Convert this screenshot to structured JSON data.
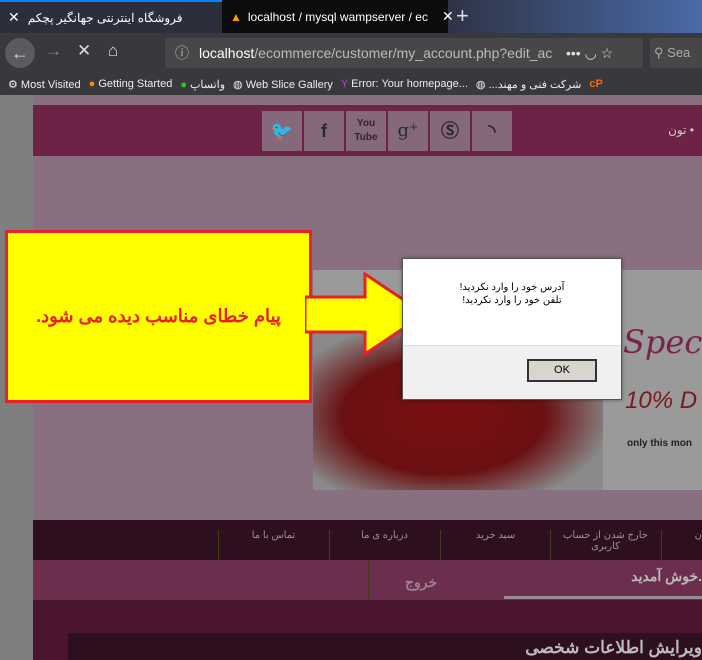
{
  "browser": {
    "tabs": [
      {
        "label": "فروشگاه اینترنتی جهانگیر پچکم"
      },
      {
        "label": "localhost / mysql wampserver / ec"
      }
    ],
    "url_host": "localhost",
    "url_path": "/ecommerce/customer/my_account.php?edit_ac",
    "search_placeholder": "Sea",
    "bookmarks": [
      "Most Visited",
      "Getting Started",
      "واتساپ",
      "Web Slice Gallery",
      "Error: Your homepage...",
      "...شرکت فنی و مهند"
    ]
  },
  "site": {
    "header_text": "تون •",
    "social": [
      "twitter",
      "facebook",
      "youtube",
      "google-plus",
      "skype",
      "rss"
    ],
    "banner": {
      "special": "Spec",
      "discount": "10% D",
      "only": "only this mon"
    },
    "menu": [
      "تماس با ما",
      "درباره ی ما",
      "سبد خرید",
      "خارج شدن از حساب کاربری",
      "ن"
    ],
    "welcome": "خوش آمدید.",
    "exit": "خروج",
    "section_title": "ویرایش اطلاعات شخصی"
  },
  "dialog": {
    "line1": "آدرس خود را وارد نکردید!",
    "line2": "تلفن خود را وارد نکردید!",
    "ok": "OK"
  },
  "annotation": {
    "text": "پیام خطای مناسب دیده می شود.",
    "bg": "#ffff00",
    "color": "#e8202a"
  }
}
